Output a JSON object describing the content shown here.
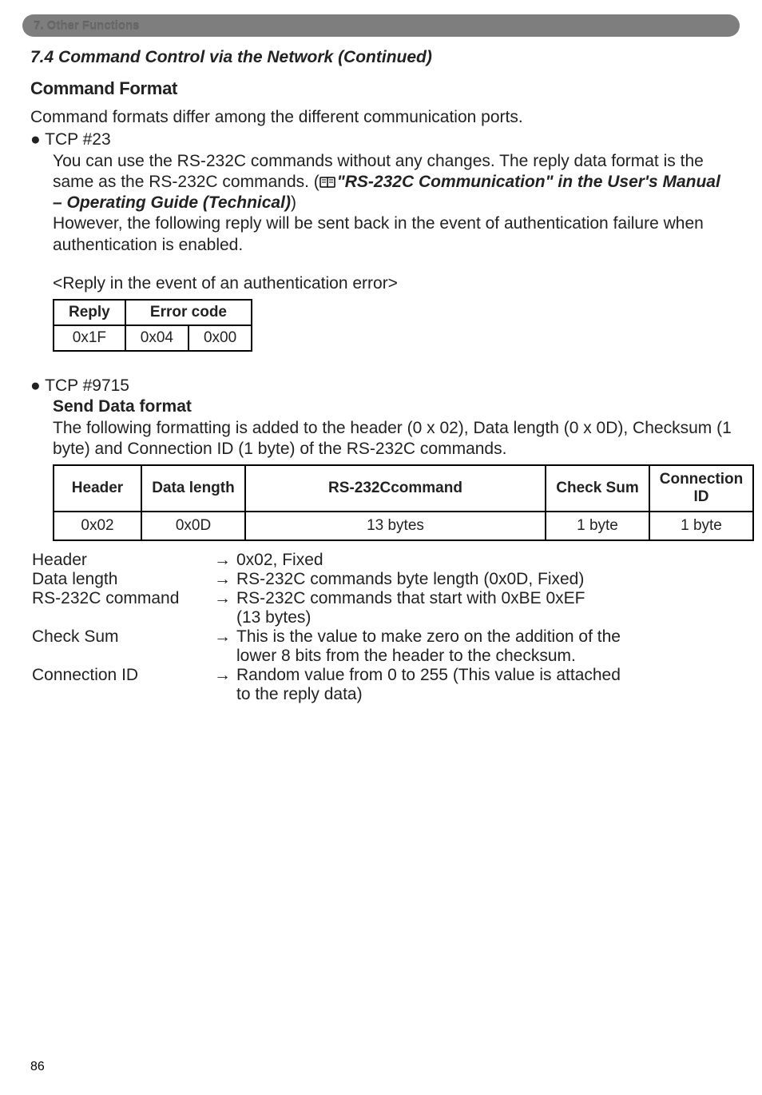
{
  "breadcrumb": "7. Other Functions",
  "section_title": "7.4 Command Control via the Network (Continued)",
  "cmd_format_heading": "Command Format",
  "intro_line": "Command formats differ among the different communication ports.",
  "tcp23": {
    "bullet": "● TCP #23",
    "line1": "You can use the RS-232C commands without any changes. The reply data format is the same as the RS-232C commands. (",
    "ref": "\"RS-232C Communication\" in the User's Manual – Operating Guide (Technical)",
    "line1_tail": ")",
    "line2": "However, the following reply will be sent back in the event of authentication failure when authentication is enabled.",
    "reply_caption": "<Reply in the event of an authentication error>",
    "table": {
      "h1": "Reply",
      "h2": "Error code",
      "c1": "0x1F",
      "c2": "0x04",
      "c3": "0x00"
    }
  },
  "tcp9715": {
    "bullet": "● TCP #9715",
    "subheading": "Send Data format",
    "desc": "The following formatting is added to the header (0 x 02), Data length (0 x 0D), Checksum (1 byte) and Connection ID (1 byte) of the RS-232C commands.",
    "table": {
      "h1": "Header",
      "h2": "Data length",
      "h3": "RS-232Ccommand",
      "h4": "Check Sum",
      "h5": "Connection ID",
      "c1": "0x02",
      "c2": "0x0D",
      "c3": "13 bytes",
      "c4": "1 byte",
      "c5": "1 byte"
    },
    "defs": {
      "header_label": "Header",
      "header_val": "0x02, Fixed",
      "datalen_label": "Data length",
      "datalen_val": "RS-232C commands byte length (0x0D, Fixed)",
      "rs232_label": "RS-232C command",
      "rs232_val_l1": "RS-232C commands that start with 0xBE 0xEF",
      "rs232_val_l2": "(13 bytes)",
      "checksum_label": "Check Sum",
      "checksum_val_l1": "This is the value to make zero on the addition of the",
      "checksum_val_l2": "lower 8 bits from the header to the checksum.",
      "connid_label": "Connection ID",
      "connid_val_l1": "Random value from 0 to 255 (This value is attached",
      "connid_val_l2": "to the reply data)"
    }
  },
  "arrow": "→",
  "page_number": "86"
}
